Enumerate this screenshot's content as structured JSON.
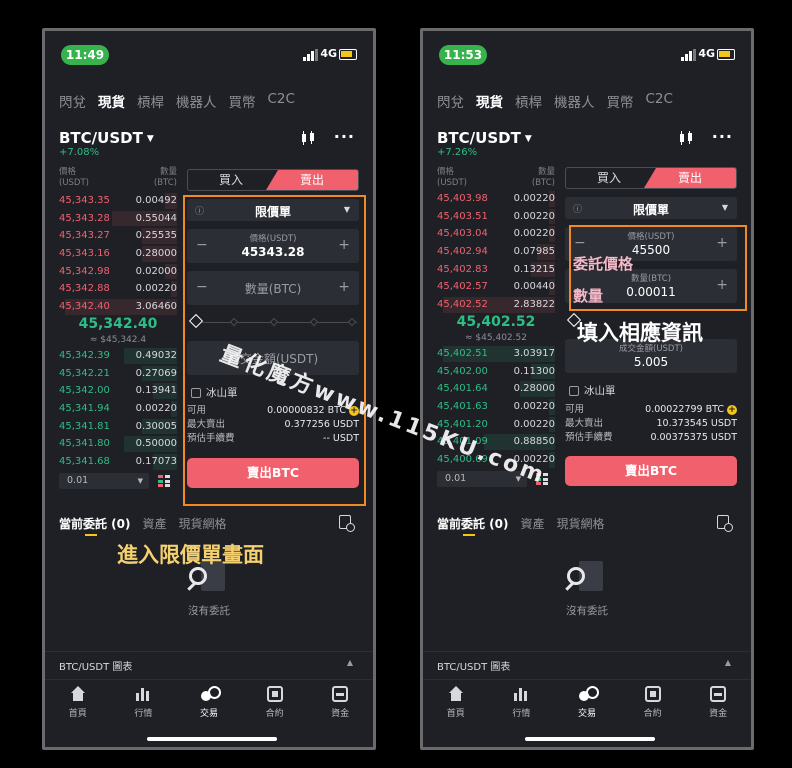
{
  "left": {
    "time": "11:49",
    "network": "4G",
    "tabs": [
      "閃兌",
      "現貨",
      "槓桿",
      "機器人",
      "買幣",
      "C2C"
    ],
    "pair": "BTC/USDT",
    "change": "+7.08%",
    "ob_header": {
      "price": "價格",
      "price_unit": "(USDT)",
      "qty": "數量",
      "qty_unit": "(BTC)"
    },
    "asks": [
      {
        "price": "45,343.35",
        "qty": "0.00492",
        "fill": 0.1
      },
      {
        "price": "45,343.28",
        "qty": "0.55044",
        "fill": 0.55
      },
      {
        "price": "45,343.27",
        "qty": "0.25535",
        "fill": 0.3
      },
      {
        "price": "45,343.16",
        "qty": "0.28000",
        "fill": 0.3
      },
      {
        "price": "45,342.98",
        "qty": "0.02000",
        "fill": 0.1
      },
      {
        "price": "45,342.88",
        "qty": "0.00220",
        "fill": 0.05
      },
      {
        "price": "45,342.40",
        "qty": "3.06460",
        "fill": 0.95
      }
    ],
    "mid_price": "45,342.40",
    "mid_sub": "≈ $45,342.4",
    "bids": [
      {
        "price": "45,342.39",
        "qty": "0.49032",
        "fill": 0.45
      },
      {
        "price": "45,342.21",
        "qty": "0.27069",
        "fill": 0.3
      },
      {
        "price": "45,342.00",
        "qty": "0.13941",
        "fill": 0.2
      },
      {
        "price": "45,341.94",
        "qty": "0.00220",
        "fill": 0.05
      },
      {
        "price": "45,341.81",
        "qty": "0.30005",
        "fill": 0.3
      },
      {
        "price": "45,341.80",
        "qty": "0.50000",
        "fill": 0.45
      },
      {
        "price": "45,341.68",
        "qty": "0.17073",
        "fill": 0.2
      }
    ],
    "depth": "0.01",
    "buy_label": "買入",
    "sell_label": "賣出",
    "order_type": "限價單",
    "price_label": "價格(USDT)",
    "price_value": "45343.28",
    "qty_placeholder": "數量(BTC)",
    "total_placeholder": "成交金額(USDT)",
    "iceberg": "冰山單",
    "available_label": "可用",
    "available_value": "0.00000832 BTC",
    "max_sell_label": "最大賣出",
    "max_sell_value": "0.377256 USDT",
    "fee_label": "預估手續費",
    "fee_value": "-- USDT",
    "sell_button": "賣出BTC",
    "annotation": "進入限價單畫面"
  },
  "right": {
    "time": "11:53",
    "network": "4G",
    "tabs": [
      "閃兌",
      "現貨",
      "槓桿",
      "機器人",
      "買幣",
      "C2C"
    ],
    "pair": "BTC/USDT",
    "change": "+7.26%",
    "ob_header": {
      "price": "價格",
      "price_unit": "(USDT)",
      "qty": "數量",
      "qty_unit": "(BTC)"
    },
    "asks": [
      {
        "price": "45,403.98",
        "qty": "0.00220",
        "fill": 0.05
      },
      {
        "price": "45,403.51",
        "qty": "0.00220",
        "fill": 0.05
      },
      {
        "price": "45,403.04",
        "qty": "0.00220",
        "fill": 0.05
      },
      {
        "price": "45,402.94",
        "qty": "0.07985",
        "fill": 0.15
      },
      {
        "price": "45,402.83",
        "qty": "0.13215",
        "fill": 0.2
      },
      {
        "price": "45,402.57",
        "qty": "0.00440",
        "fill": 0.05
      },
      {
        "price": "45,402.52",
        "qty": "2.83822",
        "fill": 0.95
      }
    ],
    "mid_price": "45,402.52",
    "mid_sub": "≈ $45,402.52",
    "bids": [
      {
        "price": "45,402.51",
        "qty": "3.03917",
        "fill": 0.95
      },
      {
        "price": "45,402.00",
        "qty": "0.11300",
        "fill": 0.2
      },
      {
        "price": "45,401.64",
        "qty": "0.28000",
        "fill": 0.3
      },
      {
        "price": "45,401.63",
        "qty": "0.00220",
        "fill": 0.05
      },
      {
        "price": "45,401.20",
        "qty": "0.00220",
        "fill": 0.05
      },
      {
        "price": "45,401.09",
        "qty": "0.88850",
        "fill": 0.6
      },
      {
        "price": "45,400.69",
        "qty": "0.00220",
        "fill": 0.05
      }
    ],
    "depth": "0.01",
    "buy_label": "買入",
    "sell_label": "賣出",
    "order_type": "限價單",
    "price_label": "價格(USDT)",
    "price_value": "45500",
    "qty_label": "數量(BTC)",
    "qty_value": "0.00011",
    "total_label": "成交金額(USDT)",
    "total_value": "5.005",
    "iceberg": "冰山單",
    "available_label": "可用",
    "available_value": "0.00022799 BTC",
    "max_sell_label": "最大賣出",
    "max_sell_value": "10.373545 USDT",
    "fee_label": "預估手續費",
    "fee_value": "0.00375375 USDT",
    "sell_button": "賣出BTC",
    "anno_price": "委託價格",
    "anno_qty": "數量",
    "annotation": "填入相應資訊"
  },
  "common": {
    "order_tabs": [
      "當前委託 (0)",
      "資產",
      "現貨網格"
    ],
    "empty_text": "沒有委託",
    "chart_bar": "BTC/USDT 圖表",
    "nav": [
      "首頁",
      "行情",
      "交易",
      "合約",
      "資金"
    ]
  },
  "watermark": "量化魔方www.115KU.com",
  "colors": {
    "ask": "#f0616d",
    "bid": "#2ebd85",
    "accent": "#f5c518",
    "annotation_box": "#f08a24"
  }
}
